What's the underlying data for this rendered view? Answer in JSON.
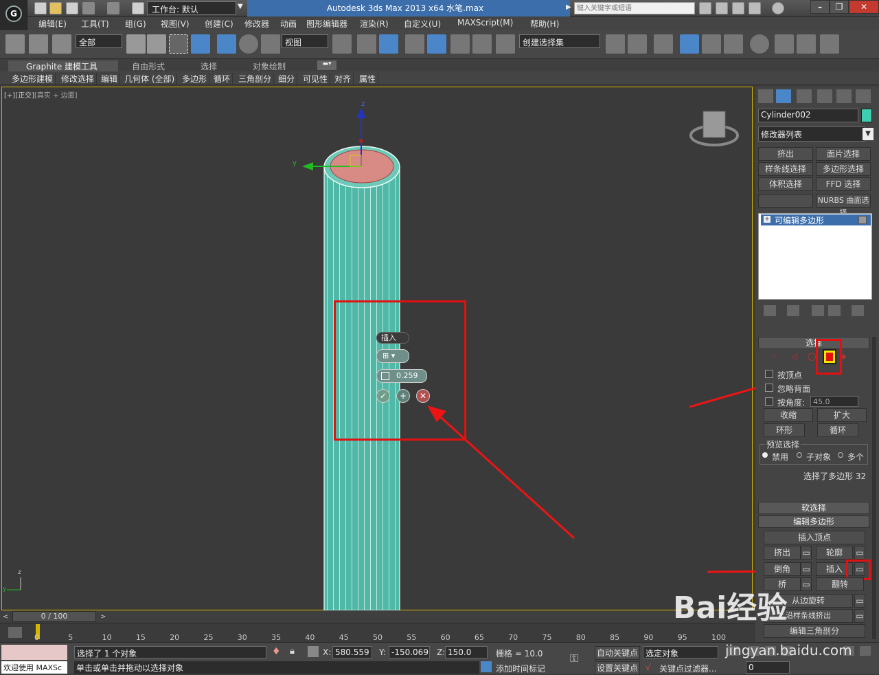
{
  "titlebar": {
    "workspace": "工作台: 默认",
    "title": "Autodesk 3ds Max  2013 x64      水笔.max",
    "search_placeholder": "键入关键字或短语"
  },
  "menu": [
    "编辑(E)",
    "工具(T)",
    "组(G)",
    "视图(V)",
    "创建(C)",
    "修改器",
    "动画",
    "图形编辑器",
    "渲染(R)",
    "自定义(U)",
    "MAXScript(M)",
    "帮助(H)"
  ],
  "toolbar": {
    "selection_filter": "全部",
    "reference_coord": "视图",
    "named_selection": "创建选择集"
  },
  "ribbon": {
    "tabs": [
      "Graphite 建模工具",
      "自由形式",
      "选择",
      "对象绘制"
    ],
    "buttons": [
      "多边形建模",
      "修改选择",
      "编辑",
      "几何体 (全部)",
      "多边形",
      "循环",
      "三角剖分",
      "细分",
      "可见性",
      "对齐",
      "属性"
    ]
  },
  "viewport": {
    "label_parts": [
      "[+]",
      "[正交]",
      "[真实 + 边面]"
    ],
    "axes": {
      "x": "x",
      "y": "y",
      "z": "z"
    },
    "caddy": {
      "title": "插入",
      "amount": "0.259",
      "accent": "#3d9e94"
    }
  },
  "panel": {
    "object_name": "Cylinder002",
    "object_color": "#3ecfb0",
    "modifier_list": "修改器列表",
    "buttons": [
      "挤出",
      "面片选择",
      "样条线选择",
      "多边形选择",
      "体积选择",
      "FFD 选择",
      "",
      "NURBS 曲面选择"
    ],
    "stack_item": "可编辑多边形",
    "selection": {
      "header": "选择",
      "by_vertex": "按顶点",
      "ignore_backfacing": "忽略背面",
      "by_angle": "按角度:",
      "angle_value": "45.0",
      "shrink": "收缩",
      "grow": "扩大",
      "ring": "环形",
      "loop": "循环",
      "preview_title": "预览选择",
      "preview_options": [
        "禁用",
        "子对象",
        "多个"
      ],
      "status": "选择了多边形 32"
    },
    "soft_selection": "软选择",
    "edit_polygons": {
      "header": "编辑多边形",
      "insert_vertex": "插入顶点",
      "extrude": "挤出",
      "outline": "轮廓",
      "bevel": "倒角",
      "inset": "插入",
      "bridge": "桥",
      "flip": "翻转",
      "hinge": "从边旋转",
      "extrude_along": "沿样条线挤出",
      "edit_tri": "编辑三角剖分"
    }
  },
  "timeline": {
    "slider": "0 / 100",
    "ticks": [
      "0",
      "5",
      "10",
      "15",
      "20",
      "25",
      "30",
      "35",
      "40",
      "45",
      "50",
      "55",
      "60",
      "65",
      "70",
      "75",
      "80",
      "85",
      "90",
      "95",
      "100"
    ]
  },
  "status": {
    "maxscript": "欢迎使用 MAXSc",
    "selected": "选择了 1 个对象",
    "prompt": "单击或单击并拖动以选择对象",
    "x_label": "X:",
    "x": "580.559",
    "y_label": "Y:",
    "y": "-150.069",
    "z_label": "Z:",
    "z": "150.0",
    "grid": "栅格 = 10.0",
    "auto_key": "自动关键点",
    "set_key": "设置关键点",
    "selected_obj": "选定对象",
    "key_filter": "关键点过滤器...",
    "add_time_tag": "添加时间标记",
    "frame": "0"
  },
  "watermark": {
    "text": "Bai经验",
    "url": "jingyan.baidu.com"
  }
}
